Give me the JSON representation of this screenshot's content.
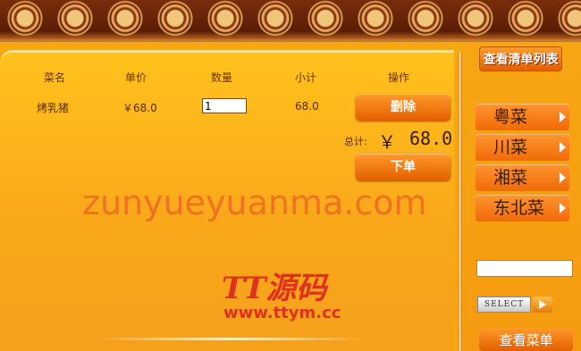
{
  "cart": {
    "headers": {
      "name": "菜名",
      "price": "单价",
      "qty": "数量",
      "subtotal": "小计",
      "action": "操作"
    },
    "rows": [
      {
        "name": "烤乳猪",
        "price": "￥68.0",
        "qty": "1",
        "subtotal": "68.0"
      }
    ],
    "delete_label": "删除",
    "total_label": "总计:",
    "total_symbol": "￥",
    "total_value": "68.0",
    "order_label": "下单"
  },
  "sidebar": {
    "list_button": "查看清单列表",
    "categories": [
      {
        "label": "粤菜"
      },
      {
        "label": "川菜"
      },
      {
        "label": "湘菜"
      },
      {
        "label": "东北菜"
      }
    ],
    "search_value": "",
    "select_label": "SELECT",
    "view_menu_label": "查看菜单"
  },
  "overlay": {
    "watermark": "zunyueyuanma.com",
    "logo_text": "TT源码",
    "logo_url": "www.ttym.cc"
  },
  "colors": {
    "background": "#f7a70f",
    "button": "#e35f00",
    "logo": "#e0301e"
  }
}
